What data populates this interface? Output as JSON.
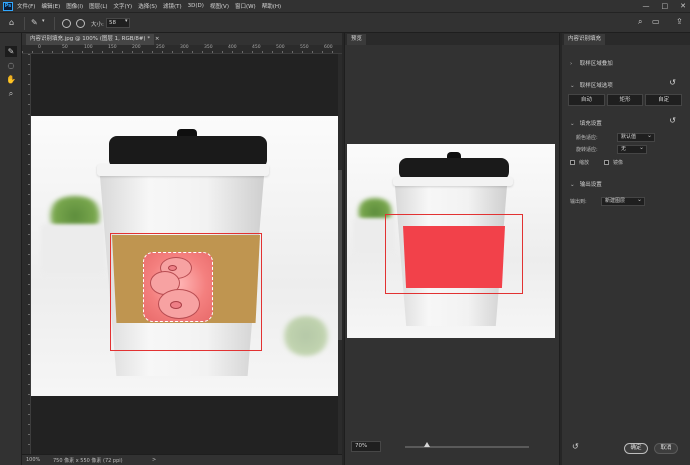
{
  "app": {
    "logo_text": "Ps",
    "menus": [
      "文件(F)",
      "编辑(E)",
      "图像(I)",
      "图层(L)",
      "文字(Y)",
      "选择(S)",
      "滤镜(T)",
      "3D(D)",
      "视图(V)",
      "窗口(W)",
      "帮助(H)"
    ],
    "window_controls": [
      "—",
      "□",
      "✕"
    ]
  },
  "options": {
    "size_label": "大小:",
    "size_value": "58"
  },
  "document": {
    "tab_title": "内容识别填充.jpg @ 100% (图层 1, RGB/8#) *",
    "tab_close": "×",
    "ruler_marks": [
      "0",
      "50",
      "100",
      "150",
      "200",
      "250",
      "300",
      "350",
      "400",
      "450",
      "500",
      "550",
      "600"
    ],
    "status_zoom": "100%",
    "status_info": "750 像素 x 550 像素 (72 ppi)",
    "status_arrow": ">"
  },
  "preview": {
    "tab_label": "预览",
    "zoom_value": "70%",
    "zoom_fraction": 0.18
  },
  "properties": {
    "tab_label": "内容识别填充",
    "section_overlay": "取样区域叠加",
    "section_sampling": "取样区域选项",
    "sampling_buttons": [
      "自动",
      "矩形",
      "自定"
    ],
    "section_fill": "填充设置",
    "color_adapt_label": "颜色适应:",
    "color_adapt_value": "默认值",
    "rotate_adapt_label": "旋转适应:",
    "rotate_adapt_value": "无",
    "scale_label": "缩放",
    "mirror_label": "镜像",
    "section_output": "输出设置",
    "output_label": "输出到:",
    "output_value": "新建图层",
    "ok_label": "确定",
    "cancel_label": "取消"
  },
  "colors": {
    "panel_bg": "#323232",
    "selection_red": "#e23232",
    "fill_red": "#f2414a",
    "sleeve_brown": "#bf9550"
  }
}
